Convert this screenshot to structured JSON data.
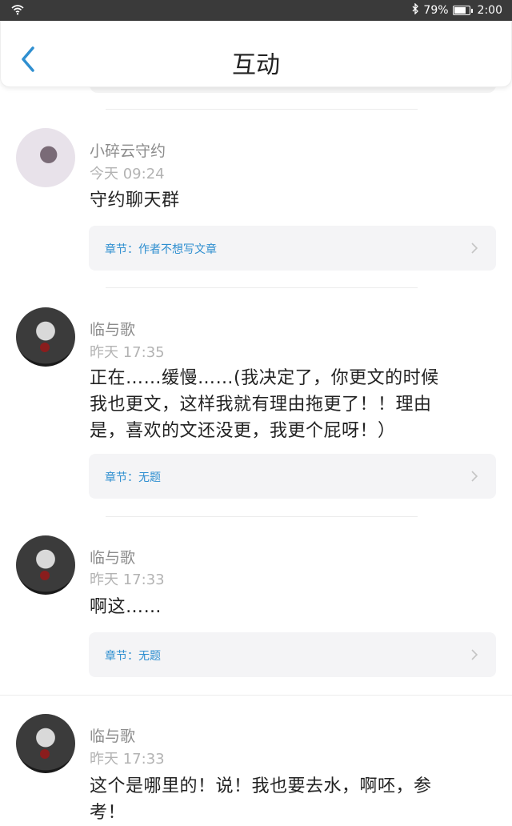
{
  "status": {
    "battery": "79%",
    "time": "2:00",
    "icons": [
      "wifi-icon",
      "bluetooth-icon",
      "battery-icon"
    ]
  },
  "header": {
    "title": "互动",
    "back_icon": "chevron-left-icon"
  },
  "comments": [
    {
      "username": "小碎云守约",
      "time": "今天 09:24",
      "content": "守约聊天群",
      "chapter": "章节：作者不想写文章"
    },
    {
      "username": "临与歌",
      "time": "昨天 17:35",
      "content_lines": [
        "正在……缓慢……(我决定了，你更文的时候",
        "我也更文，这样我就有理由拖更了！！理由",
        "是，喜欢的文还没更，我更个屁呀！）"
      ],
      "chapter": "章节：无题"
    },
    {
      "username": "临与歌",
      "time": "昨天 17:33",
      "content": "啊这……",
      "chapter": "章节：无题"
    },
    {
      "username": "临与歌",
      "time": "昨天 17:33",
      "content_lines": [
        "这个是哪里的！说！我也要去水，啊呸，参",
        "考！"
      ]
    }
  ],
  "colors": {
    "accent": "#2f8fd0",
    "status_bar": "#3a3a3a",
    "card_bg": "#f4f4f6"
  }
}
